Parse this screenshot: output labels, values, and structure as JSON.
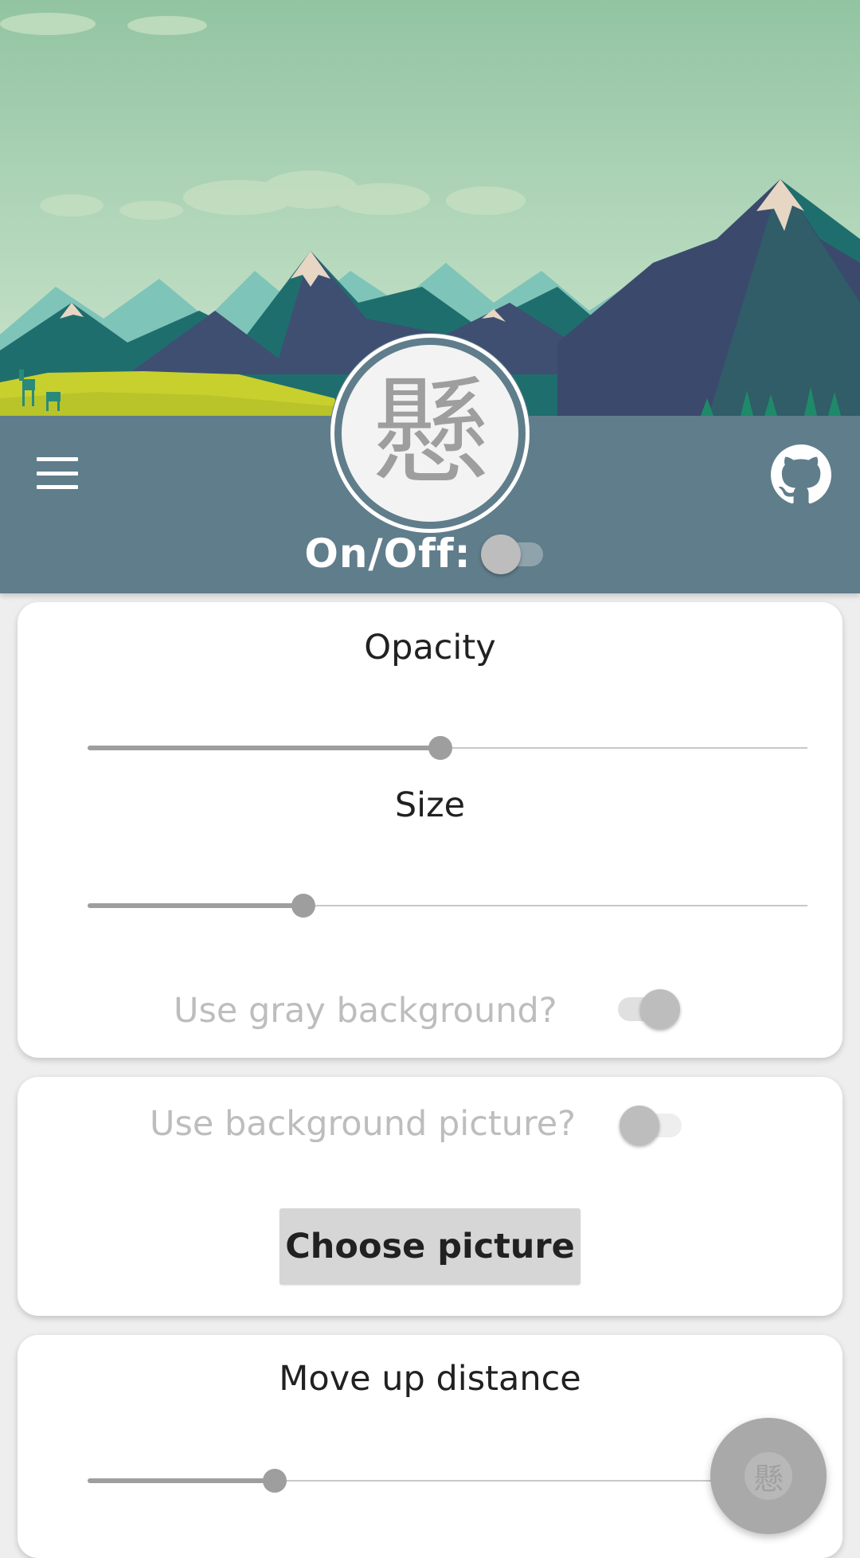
{
  "header": {
    "logo_glyph": "懸",
    "menu_icon": "hamburger-menu-icon",
    "github_icon": "github-icon",
    "onoff_label": "On/Off:",
    "onoff_enabled": false
  },
  "card_appearance": {
    "opacity_title": "Opacity",
    "opacity_value": 0.49,
    "size_title": "Size",
    "size_value": 0.3,
    "gray_bg_label": "Use gray background?",
    "gray_bg_enabled": true
  },
  "card_background": {
    "bg_picture_label": "Use background picture?",
    "bg_picture_enabled": false,
    "choose_button_label": "Choose picture"
  },
  "card_position": {
    "move_up_title": "Move up distance",
    "move_up_value": 0.26
  },
  "fab": {
    "glyph": "懸"
  },
  "colors": {
    "appbar": "#607d8b",
    "card": "#ffffff",
    "slider_active": "#9e9e9e",
    "disabled_text": "#bdbdbd"
  }
}
